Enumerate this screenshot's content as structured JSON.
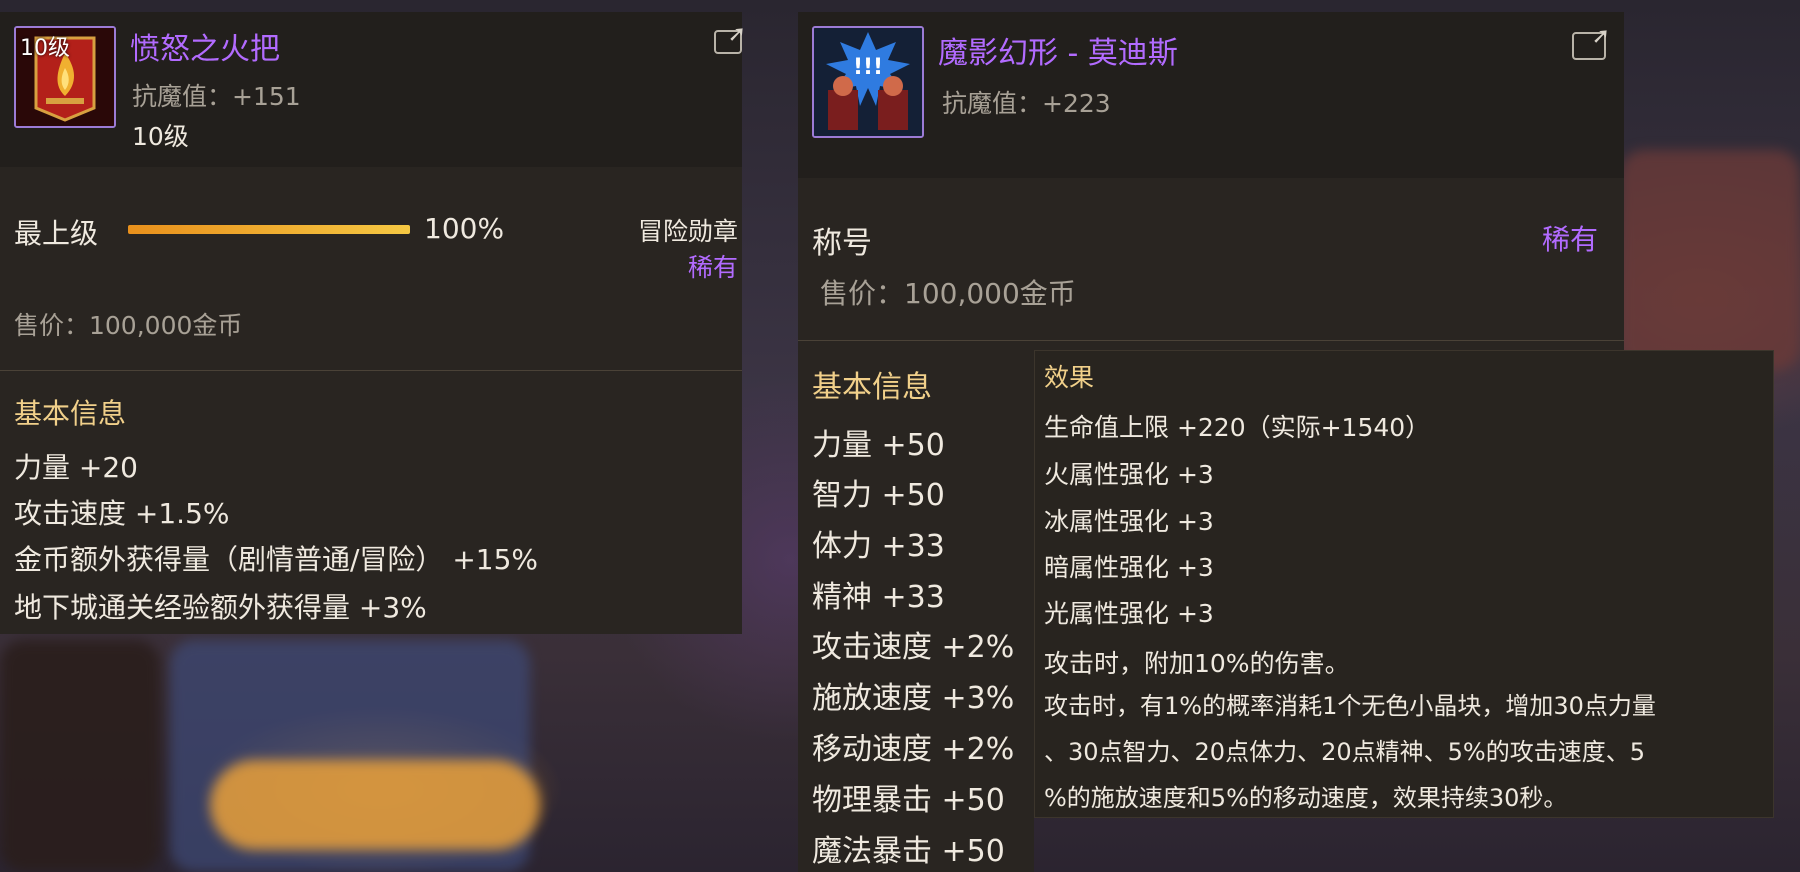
{
  "left_item": {
    "icon_level": "10级",
    "name": "愤怒之火把",
    "magic_resist": "抗魔值：+151",
    "level": "10级",
    "upgrade_label": "最上级",
    "upgrade_percent": "100%",
    "progress": 1.0,
    "category": "冒险勋章",
    "rarity": "稀有",
    "price": "售价：100,000金币",
    "basic_info_title": "基本信息",
    "stats": [
      "力量 +20",
      "攻击速度 +1.5%",
      "金币额外获得量（剧情普通/冒险） +15%",
      "地下城通关经验额外获得量 +3%"
    ]
  },
  "right_item": {
    "name": "魔影幻形 - 莫迪斯",
    "magic_resist": "抗魔值：+223",
    "category": "称号",
    "rarity": "稀有",
    "price": "售价：100,000金币",
    "basic_info_title": "基本信息",
    "stats": [
      "力量 +50",
      "智力 +50",
      "体力 +33",
      "精神 +33",
      "攻击速度 +2%",
      "施放速度 +3%",
      "移动速度 +2%",
      "物理暴击 +50",
      "魔法暴击 +50"
    ],
    "effects_title": "效果",
    "effects": [
      "生命值上限 +220（实际+1540）",
      "火属性强化 +3",
      "冰属性强化 +3",
      "暗属性强化 +3",
      "光属性强化 +3",
      "攻击时，附加10%的伤害。",
      "攻击时，有1%的概率消耗1个无色小晶块，增加30点力量",
      "、30点智力、20点体力、20点精神、5%的攻击速度、5",
      "%的施放速度和5%的移动速度，效果持续30秒。"
    ]
  },
  "colors": {
    "panel_bg": "#292521",
    "rarity_purple": "#b26bff",
    "progress_gold": "#f5b42a"
  },
  "icons": [
    "torch-banner-icon",
    "title-character-icon",
    "share-icon"
  ]
}
